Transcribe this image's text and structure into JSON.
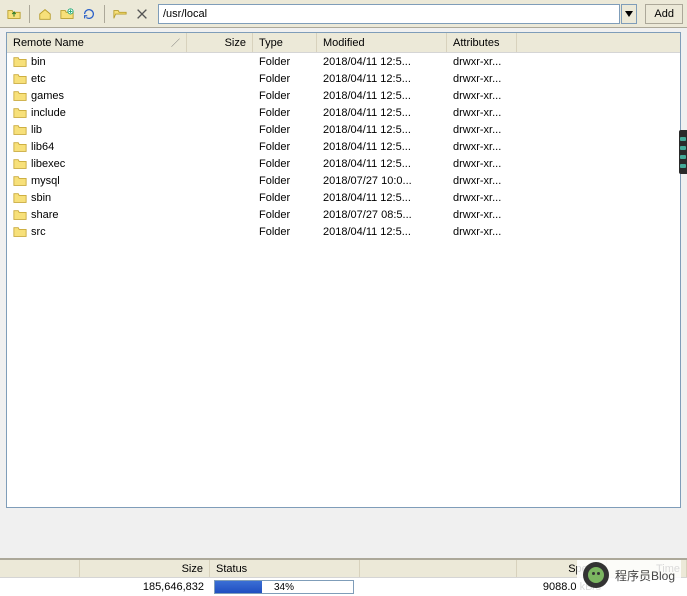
{
  "toolbar": {
    "path": "/usr/local",
    "add_label": "Add"
  },
  "columns": {
    "name": "Remote Name",
    "size": "Size",
    "type": "Type",
    "modified": "Modified",
    "attributes": "Attributes"
  },
  "rows": [
    {
      "name": "bin",
      "type": "Folder",
      "modified": "2018/04/11 12:5...",
      "attr": "drwxr-xr..."
    },
    {
      "name": "etc",
      "type": "Folder",
      "modified": "2018/04/11 12:5...",
      "attr": "drwxr-xr..."
    },
    {
      "name": "games",
      "type": "Folder",
      "modified": "2018/04/11 12:5...",
      "attr": "drwxr-xr..."
    },
    {
      "name": "include",
      "type": "Folder",
      "modified": "2018/04/11 12:5...",
      "attr": "drwxr-xr..."
    },
    {
      "name": "lib",
      "type": "Folder",
      "modified": "2018/04/11 12:5...",
      "attr": "drwxr-xr..."
    },
    {
      "name": "lib64",
      "type": "Folder",
      "modified": "2018/04/11 12:5...",
      "attr": "drwxr-xr..."
    },
    {
      "name": "libexec",
      "type": "Folder",
      "modified": "2018/04/11 12:5...",
      "attr": "drwxr-xr..."
    },
    {
      "name": "mysql",
      "type": "Folder",
      "modified": "2018/07/27 10:0...",
      "attr": "drwxr-xr..."
    },
    {
      "name": "sbin",
      "type": "Folder",
      "modified": "2018/04/11 12:5...",
      "attr": "drwxr-xr..."
    },
    {
      "name": "share",
      "type": "Folder",
      "modified": "2018/07/27 08:5...",
      "attr": "drwxr-xr..."
    },
    {
      "name": "src",
      "type": "Folder",
      "modified": "2018/04/11 12:5...",
      "attr": "drwxr-xr..."
    }
  ],
  "transfer_columns": {
    "size": "Size",
    "status": "Status",
    "speed": "Speed",
    "time": "Time"
  },
  "transfer_row": {
    "size": "185,646,832",
    "progress_percent": 34,
    "progress_label": "34%",
    "speed": "9088.0 kB/s"
  },
  "watermark_text": "程序员Blog"
}
